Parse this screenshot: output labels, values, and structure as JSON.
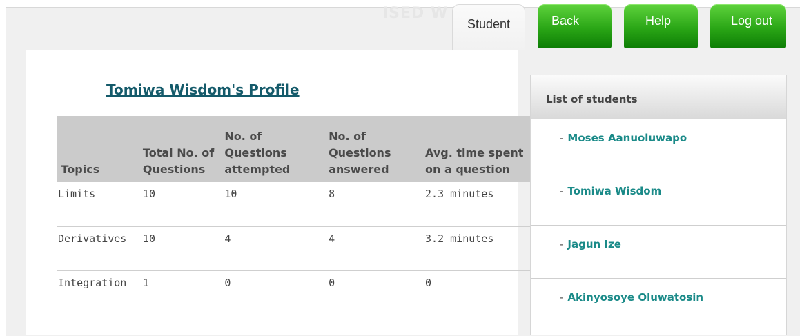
{
  "watermark_text": "ISED W",
  "nav": {
    "student_tab": "Student",
    "back": "Back",
    "help": "Help",
    "logout": "Log out"
  },
  "profile": {
    "title": "Tomiwa Wisdom's Profile",
    "columns": [
      "Topics",
      "Total No. of Questions",
      "No. of Questions attempted",
      "No. of Questions answered",
      "Avg. time spent on a question"
    ],
    "rows": [
      [
        "Limits",
        "10",
        "10",
        "8",
        "2.3 minutes"
      ],
      [
        "Derivatives",
        "10",
        "4",
        "4",
        "3.2 minutes"
      ],
      [
        "Integration",
        "1",
        "0",
        "0",
        "0"
      ]
    ]
  },
  "sidebar": {
    "header": "List of students",
    "students": [
      "Moses Aanuoluwapo",
      "Tomiwa Wisdom",
      "Jagun Ize",
      "Akinyosoye Oluwatosin"
    ]
  },
  "colors": {
    "green_button": "#2aa616",
    "title": "#145a6a",
    "student_link": "#1a8a88",
    "table_header": "#cbcbcb"
  }
}
